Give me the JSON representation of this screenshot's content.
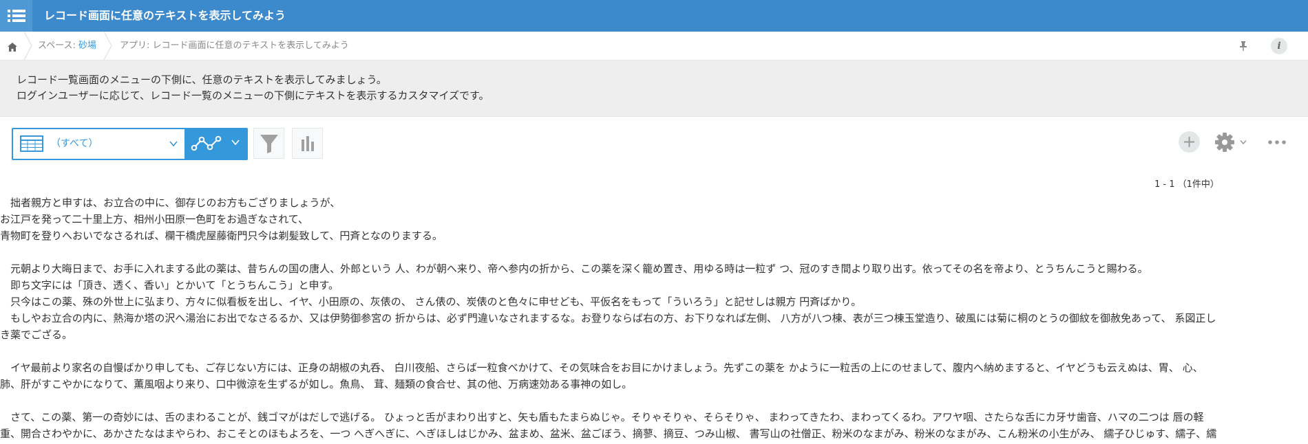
{
  "header": {
    "title": "レコード画面に任意のテキストを表示してみよう"
  },
  "breadcrumb": {
    "space_prefix": "スペース: ",
    "space_name": "砂場",
    "app_prefix": "アプリ: ",
    "app_name": "レコード画面に任意のテキストを表示してみよう"
  },
  "notice": {
    "line1": "レコード一覧画面のメニューの下側に、任意のテキストを表示してみましょう。",
    "line2": "ログインユーザーに応じて、レコード一覧のメニューの下側にテキストを表示するカスタマイズです。"
  },
  "view": {
    "selected": "（すべて）"
  },
  "pager": {
    "text": "1 - 1 （1件中）"
  },
  "content": {
    "lines": [
      "　拙者親方と申すは、お立合の中に、御存じのお方もござりましょうが、",
      "お江戸を発って二十里上方、相州小田原一色町をお過ぎなされて、",
      "青物町を登りへおいでなさるれば、欄干橋虎屋藤衛門只今は剃髪致して、円斉となのりまする。",
      "",
      "　元朝より大晦日まで、お手に入れまする此の薬は、昔ちんの国の唐人、外郎という 人、わが朝へ来り、帝へ参内の折から、この薬を深く籠め置き、用ゆる時は一粒ず つ、冠のすき間より取り出す。依ってその名を帝より、とうちんこうと賜わる。",
      "　即ち文字には「頂き、透く、香い」とかいて「とうちんこう」と申す。",
      "　只今はこの薬、殊の外世上に弘まり、方々に似看板を出し、イヤ、小田原の、灰俵の、 さん俵の、炭俵のと色々に申せども、平仮名をもって「ういろう」と記せしは親方 円斉ばかり。",
      "　もしやお立合の内に、熱海か塔の沢へ湯治にお出でなさるるか、又は伊勢御参宮の 折からは、必ず門違いなされまするな。お登りならば右の方、お下りなれば左側、 八方が八つ棟、表が三つ棟玉堂造り、破風には菊に桐のとうの御紋を御赦免あって、 系図正し",
      "き薬でござる。",
      "",
      "　イヤ最前より家名の自慢ばかり申しても、ご存じない方には、正身の胡椒の丸呑、 白川夜船、さらば一粒食べかけて、その気味合をお目にかけましょう。先ずこの薬を かように一粒舌の上にのせまして、腹内へ納めますると、イヤどうも云えぬは、胃、 心、",
      "肺、肝がすこやかになりて、薫風咽より来り、口中微涼を生ずるが如し。魚鳥、 茸、麺類の食合せ、其の他、万病速効ある事神の如し。",
      "",
      "　さて、この薬、第一の奇妙には、舌のまわることが、銭ゴマがはだしで逃げる。 ひょっと舌がまわり出すと、矢も盾もたまらぬじゃ。そりゃそりゃ、そらそりゃ、 まわってきたわ、まわってくるわ。アワヤ咽、さたらな舌にカ牙サ歯音、ハマの二つは 唇の軽",
      "重、開合さわやかに、あかさたなはまやらわ、おこそとのほもよろを、一つ へぎへぎに、へぎほしはじかみ、盆まめ、盆米、盆ごぼう、摘蓼、摘豆、つみ山椒、 書写山の社僧正、粉米のなまがみ、粉米のなまがみ、こん粉米の小生がみ、 繻子ひじゅす、繻子、繻"
    ]
  }
}
